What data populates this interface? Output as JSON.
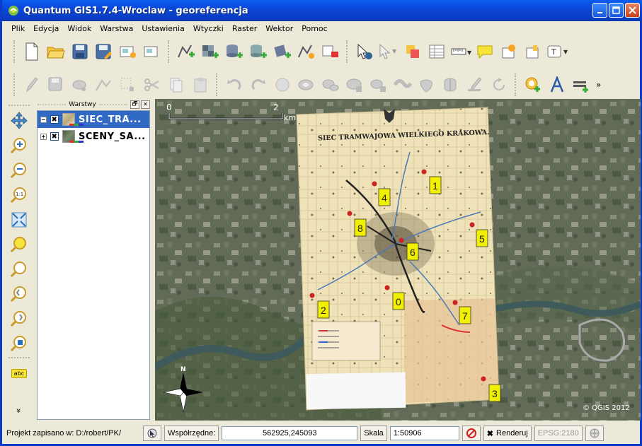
{
  "window": {
    "title": "Quantum GIS1.7.4-Wroclaw - georeferencja"
  },
  "menu": [
    "Plik",
    "Edycja",
    "Widok",
    "Warstwa",
    "Ustawienia",
    "Wtyczki",
    "Raster",
    "Wektor",
    "Pomoc"
  ],
  "panel": {
    "title": "Warstwy",
    "float_btn": "🗗",
    "close_btn": "✕"
  },
  "layers": [
    {
      "name": "SIEC_TRA...",
      "checked": "✖",
      "selected": true
    },
    {
      "name": "SCENY_SA...",
      "checked": "✖",
      "selected": false
    }
  ],
  "map": {
    "scalebar_start": "0",
    "scalebar_end": "2",
    "scalebar_unit": "km",
    "map_title": "SIEC TRAMWAJOWA WIELKIEGO KRAKOWA.",
    "copyright": "© QGIS 2012",
    "north_label": "N",
    "markers": [
      "1",
      "4",
      "8",
      "5",
      "6",
      "2",
      "0",
      "7",
      "3"
    ]
  },
  "status": {
    "project": "Projekt zapisano w: D:/robert/PK/",
    "coord_label": "Współrzędne:",
    "coord_value": "562925,245093",
    "scale_label": "Skala",
    "scale_value": "1:50906",
    "render_check": "✖",
    "render_label": "Renderuj",
    "epsg": "EPSG:2180"
  },
  "leftbar": {
    "label_tool": "abc",
    "more": "»"
  },
  "toolbar": {
    "more": "»"
  },
  "colors": {
    "titlebar": "#0a48d8",
    "selection": "#316ac5",
    "marker": "#f0f000"
  }
}
